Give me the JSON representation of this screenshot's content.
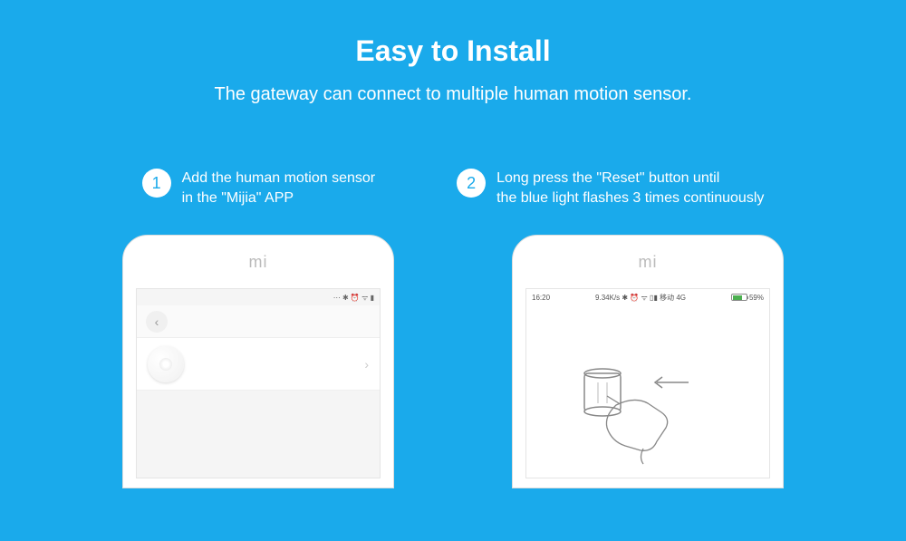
{
  "header": {
    "title": "Easy to Install",
    "subtitle": "The gateway can connect to multiple human motion sensor."
  },
  "steps": [
    {
      "number": "1",
      "text": "Add the human motion sensor\n in the \"Mijia\" APP"
    },
    {
      "number": "2",
      "text": "Long press the \"Reset\" button until\nthe blue light flashes 3 times continuously"
    }
  ],
  "phone1": {
    "logo": "mi",
    "status_icons": "⋯ ✱ ⏰ ᯤ ▮"
  },
  "phone2": {
    "logo": "mi",
    "time": "16:20",
    "speed": "9.34K/s",
    "net": "4G",
    "battery": "59%",
    "icons": "✱ ⏰ ᯤ ▯▮ 移动"
  }
}
